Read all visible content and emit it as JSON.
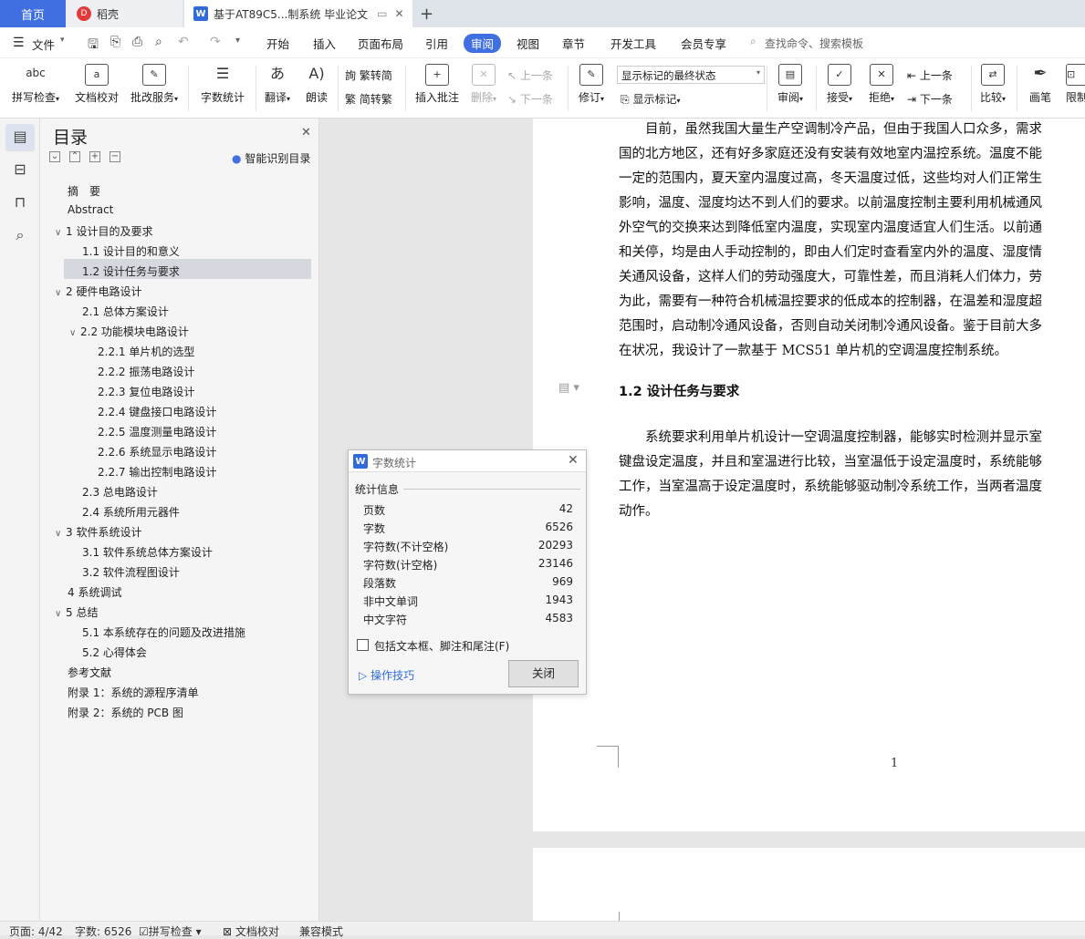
{
  "tabs": {
    "home": "首页",
    "daoke": "稻壳",
    "doc": "基于AT89C5...制系统 毕业论文"
  },
  "menu": {
    "file": "文件",
    "items": [
      "开始",
      "插入",
      "页面布局",
      "引用",
      "审阅",
      "视图",
      "章节",
      "开发工具",
      "会员专享"
    ],
    "search": "查找命令、搜索模板"
  },
  "ribbon": {
    "spell": "拼写检查",
    "proof": "文档校对",
    "batch": "批改服务",
    "count": "字数统计",
    "translate": "翻译",
    "read": "朗读",
    "t2s": "繁转简",
    "s2t": "简转繁",
    "insert_comment": "插入批注",
    "delete": "删除",
    "prev": "上一条",
    "next": "下一条",
    "track": "修订",
    "markup_select": "显示标记的最终状态",
    "show_markup": "显示标记",
    "review": "审阅",
    "accept": "接受",
    "reject": "拒绝",
    "prev2": "上一条",
    "next2": "下一条",
    "compare": "比较",
    "ink": "画笔",
    "limit": "限制",
    "abc": "abc"
  },
  "toc": {
    "title": "目录",
    "smart": "智能识别目录",
    "items": [
      "摘　要",
      "Abstract",
      "1  设计目的及要求",
      "1.1  设计目的和意义",
      "1.2  设计任务与要求",
      "2  硬件电路设计",
      "2.1  总体方案设计",
      "2.2  功能模块电路设计",
      "2.2.1  单片机的选型",
      "2.2.2  振荡电路设计",
      "2.2.3  复位电路设计",
      "2.2.4  键盘接口电路设计",
      "2.2.5  温度测量电路设计",
      "2.2.6  系统显示电路设计",
      "2.2.7  输出控制电路设计",
      "2.3  总电路设计",
      "2.4  系统所用元器件",
      "3  软件系统设计",
      "3.1  软件系统总体方案设计",
      "3.2  软件流程图设计",
      "4  系统调试",
      "5  总结",
      "5.1  本系统存在的问题及改进措施",
      "5.2  心得体会",
      "参考文献",
      "附录 1：系统的源程序清单",
      "附录 2：系统的 PCB 图"
    ]
  },
  "doc": {
    "para1": [
      "　　目前，虽然我国大量生产空调制冷产品，但由于我国人口众多，需求",
      "国的北方地区，还有好多家庭还没有安装有效地室内温控系统。温度不能",
      "一定的范围内，夏天室内温度过高，冬天温度过低，这些均对人们正常生",
      "影响，温度、湿度均达不到人们的要求。以前温度控制主要利用机械通风",
      "外空气的交换来达到降低室内温度，实现室内温度适宜人们生活。以前通",
      "和关停，均是由人手动控制的，即由人们定时查看室内外的温度、湿度情",
      "关通风设备，这样人们的劳动强度大，可靠性差，而且消耗人们体力，劳",
      "为此，需要有一种符合机械温控要求的低成本的控制器，在温差和湿度超",
      "范围时，启动制冷通风设备，否则自动关闭制冷通风设备。鉴于目前大多",
      "在状况，我设计了一款基于 MCS51 单片机的空调温度控制系统。"
    ],
    "heading": "1.2  设计任务与要求",
    "para2": [
      "　　系统要求利用单片机设计一空调温度控制器，能够实时检测并显示室",
      "键盘设定温度，并且和室温进行比较，当室温低于设定温度时，系统能够",
      "工作，当室温高于设定温度时，系统能够驱动制冷系统工作，当两者温度",
      "动作。"
    ],
    "page_num": "1"
  },
  "dialog": {
    "title": "字数统计",
    "section": "统计信息",
    "rows": [
      {
        "k": "页数",
        "v": "42"
      },
      {
        "k": "字数",
        "v": "6526"
      },
      {
        "k": "字符数(不计空格)",
        "v": "20293"
      },
      {
        "k": "字符数(计空格)",
        "v": "23146"
      },
      {
        "k": "段落数",
        "v": "969"
      },
      {
        "k": "非中文单词",
        "v": "1943"
      },
      {
        "k": "中文字符",
        "v": "4583"
      }
    ],
    "checkbox": "包括文本框、脚注和尾注(F)",
    "tips": "操作技巧",
    "close": "关闭"
  },
  "status": {
    "page": "页面: 4/42",
    "words": "字数: 6526",
    "spell": "拼写检查",
    "proof": "文档校对",
    "compat": "兼容模式"
  }
}
